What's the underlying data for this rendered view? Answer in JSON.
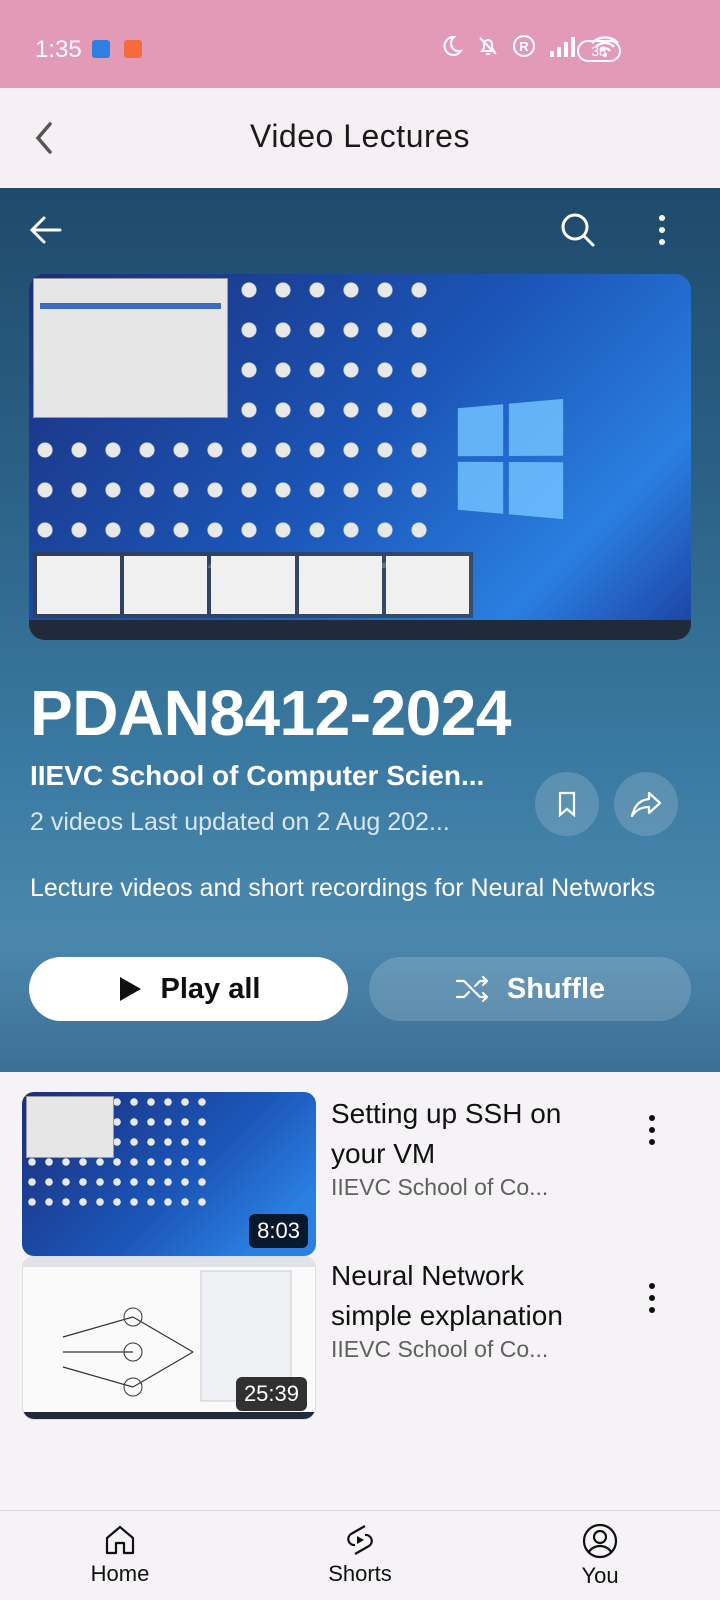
{
  "status_bar": {
    "time": "1:35",
    "battery": "38",
    "bg_color": "#e39ab6"
  },
  "header": {
    "title": "Video Lectures",
    "back_icon": "chevron-left-icon"
  },
  "hero": {
    "icons": [
      "arrow-left-icon",
      "search-icon",
      "more-vert-icon"
    ],
    "playlist_title": "PDAN8412-2024",
    "channel": "IIEVC School of Computer Scien...",
    "meta": "2 videos  Last updated on 2 Aug 202...",
    "description": "Lecture videos and short recordings for Neural Networks",
    "save_icon": "bookmark-icon",
    "share_icon": "share-icon",
    "play_all_label": "Play all",
    "shuffle_label": "Shuffle"
  },
  "videos": [
    {
      "title": "Setting up SSH on your VM",
      "channel": "IIEVC School of Co...",
      "duration": "8:03"
    },
    {
      "title": "Neural Network simple explanation",
      "channel": "IIEVC School of Co...",
      "duration": "25:39"
    }
  ],
  "bottom_nav": [
    {
      "label": "Home",
      "icon": "home-icon"
    },
    {
      "label": "Shorts",
      "icon": "shorts-icon"
    },
    {
      "label": "You",
      "icon": "account-icon"
    }
  ]
}
